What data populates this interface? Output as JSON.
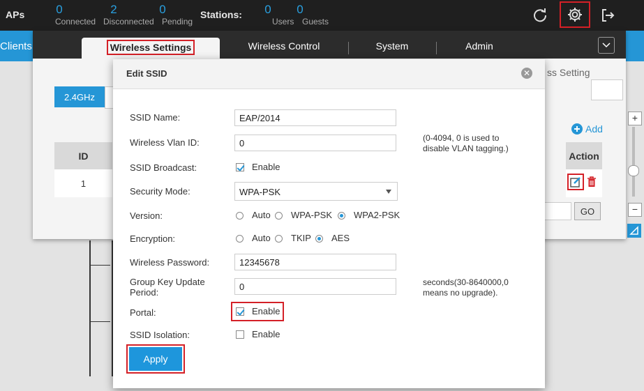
{
  "topbar": {
    "aps_title": "APs",
    "aps_stats": [
      {
        "value": "0",
        "label": "Connected"
      },
      {
        "value": "2",
        "label": "Disconnected"
      },
      {
        "value": "0",
        "label": "Pending"
      }
    ],
    "stations_title": "Stations:",
    "station_stats": [
      {
        "value": "0",
        "label": "Users"
      },
      {
        "value": "0",
        "label": "Guests"
      }
    ]
  },
  "background": {
    "clients_label": "Clients",
    "zoom_in": "+",
    "zoom_out": "−"
  },
  "settings_panel": {
    "tabs": [
      "Wireless Settings",
      "Wireless Control",
      "System",
      "Admin"
    ],
    "band_button": "2.4GHz",
    "behind_text": "ss Setting",
    "table_header_id": "ID",
    "table_row_id": "1",
    "table_header_action": "Action",
    "add_label": "Add",
    "go_label": "GO"
  },
  "dialog": {
    "title": "Edit SSID",
    "close_glyph": "✕",
    "ssid_name_label": "SSID Name:",
    "ssid_name_value": "EAP/2014",
    "vlan_label": "Wireless Vlan ID:",
    "vlan_value": "0",
    "vlan_hint_1": "(0-4094, 0 is used to",
    "vlan_hint_2": "disable VLAN tagging.)",
    "broadcast_label": "SSID Broadcast:",
    "broadcast_option": "Enable",
    "security_label": "Security Mode:",
    "security_value": "WPA-PSK",
    "version_label": "Version:",
    "version_options": [
      "Auto",
      "WPA-PSK",
      "WPA2-PSK"
    ],
    "encryption_label": "Encryption:",
    "encryption_options": [
      "Auto",
      "TKIP",
      "AES"
    ],
    "password_label": "Wireless Password:",
    "password_value": "12345678",
    "group_key_label_1": "Group Key Update",
    "group_key_label_2": "Period:",
    "group_key_value": "0",
    "group_key_hint_1": "seconds(30-8640000,0",
    "group_key_hint_2": "means no upgrade).",
    "portal_label": "Portal:",
    "portal_option": "Enable",
    "isolation_label": "SSID Isolation:",
    "isolation_option": "Enable",
    "apply_label": "Apply"
  }
}
